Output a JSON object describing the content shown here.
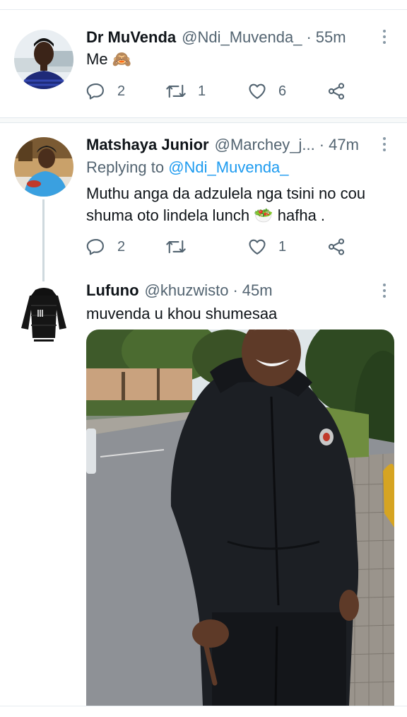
{
  "tweets": [
    {
      "name": "Dr MuVenda",
      "handle": "@Ndi_Muvenda_",
      "time": "55m",
      "text": "Me 🙈",
      "replies": "2",
      "retweets": "1",
      "likes": "6"
    },
    {
      "name": "Matshaya Junior",
      "handle": "@Marchey_j...",
      "time": "47m",
      "replying_prefix": "Replying to",
      "replying_handle": "@Ndi_Muvenda_",
      "text": "Muthu anga da adzulela nga tsini no cou shuma oto lindela lunch 🥗 hafha .",
      "replies": "2",
      "retweets": "",
      "likes": "1"
    },
    {
      "name": "Lufuno",
      "handle": "@khuzwisto",
      "time": "45m",
      "text": "muvenda  u khou shumesaa"
    }
  ],
  "separator": "·",
  "icons": [
    "reply-icon",
    "retweet-icon",
    "like-icon",
    "share-icon",
    "more-icon"
  ],
  "colors": {
    "accent": "#1d9bf0",
    "secondary_text": "#536471",
    "divider": "#e1e8ed"
  }
}
